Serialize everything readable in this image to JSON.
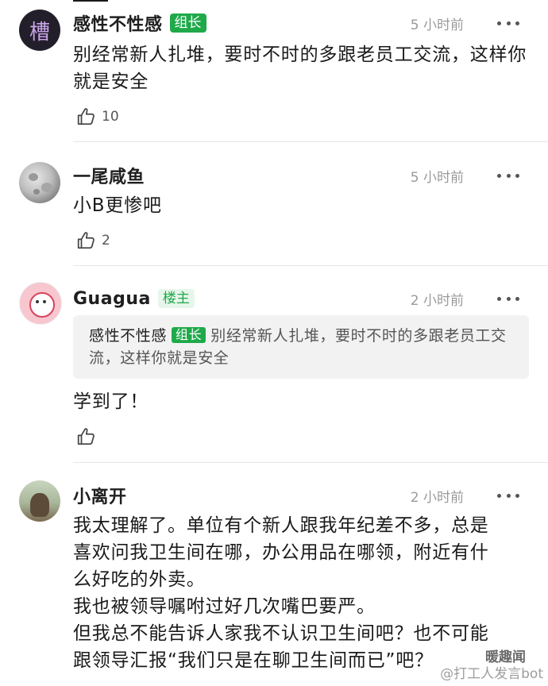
{
  "comments": [
    {
      "avatar": "槽",
      "username": "感性不性感",
      "badge": "组长",
      "time": "5 小时前",
      "text": "别经常新人扎堆，要时不时的多跟老员工交流，这样你就是安全",
      "likes": "10"
    },
    {
      "username": "一尾咸鱼",
      "time": "5 小时前",
      "text": "小B更惨吧",
      "likes": "2"
    },
    {
      "username": "Guagua",
      "badge": "楼主",
      "time": "2 小时前",
      "quote": {
        "username": "感性不性感",
        "badge": "组长",
        "text": "别经常新人扎堆，要时不时的多跟老员工交流，这样你就是安全"
      },
      "text": "学到了！"
    },
    {
      "username": "小离开",
      "time": "2 小时前",
      "lines": [
        "我太理解了。单位有个新人跟我年纪差不多，总是",
        "喜欢问我卫生间在哪，办公用品在哪领，附近有什",
        "么好吃的外卖。",
        "我也被领导嘱咐过好几次嘴巴要严。",
        "但我总不能告诉人家我不认识卫生间吧？也不可能",
        "跟领导汇报“我们只是在聊卫生间而已”吧？"
      ]
    }
  ],
  "watermark": {
    "top": "暖趣闻",
    "bottom": "@打工人发言bot"
  },
  "colors": {
    "badge_green": "#1fa94a",
    "badge_light_bg": "#e7f6ea",
    "divider": "#e6e6e6",
    "quote_bg": "#f2f2f2"
  },
  "icons": [
    "thumbs-up-icon",
    "more-icon"
  ]
}
